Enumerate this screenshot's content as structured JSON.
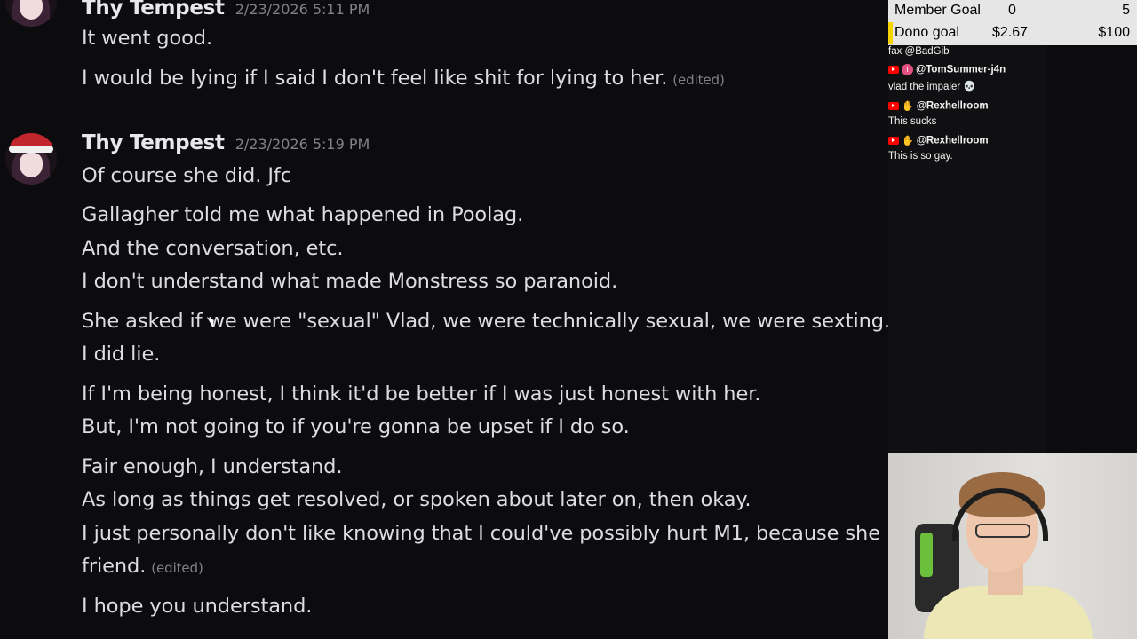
{
  "messages": [
    {
      "username": "Thy Tempest",
      "timestamp": "2/23/2026 5:11 PM",
      "lines": [
        "It went good.",
        "I would be lying if I said I don't feel like shit for lying to her."
      ],
      "edited": "(edited)"
    },
    {
      "username": "Thy Tempest",
      "timestamp": "2/23/2026 5:19 PM",
      "lines": [
        "Of course she did. Jfc",
        "Gallagher told me what happened in Poolag.",
        "And the conversation, etc.",
        "I don't understand what made Monstress so paranoid.",
        "She asked if we were \"sexual\" Vlad, we were technically sexual, we were sexting.",
        "I did lie.",
        "If I'm being honest, I think it'd be better if I was just honest with her.",
        "But, I'm not going to if you're gonna be upset if I do so.",
        "Fair enough, I understand.",
        "As long as things get resolved, or spoken about later on, then okay.",
        "I just personally don't like knowing that I could've possibly hurt M1, because she",
        "friend.",
        "I hope you understand."
      ],
      "edited": "(edited)"
    }
  ],
  "overlay": {
    "member_goal": {
      "label": "Member Goal",
      "current": "0",
      "target": "5"
    },
    "dono_goal": {
      "label": "Dono goal",
      "current": "$2.67",
      "target": "$100"
    },
    "chat": [
      {
        "user": "",
        "text": "fax @BadGib"
      },
      {
        "user": "@TomSummer-j4n",
        "badge": "T",
        "text": "vlad the impaler 💀"
      },
      {
        "user": "@Rexhellroom",
        "badge": "hand",
        "text": "This sucks"
      },
      {
        "user": "@Rexhellroom",
        "badge": "hand",
        "text": "This is so gay."
      }
    ]
  },
  "colors": {
    "background": "#0c0c0e",
    "username": "#e8e8ea",
    "timestamp": "#7f828a",
    "goal_accent": "#f6d400",
    "youtube": "#ff0000"
  }
}
